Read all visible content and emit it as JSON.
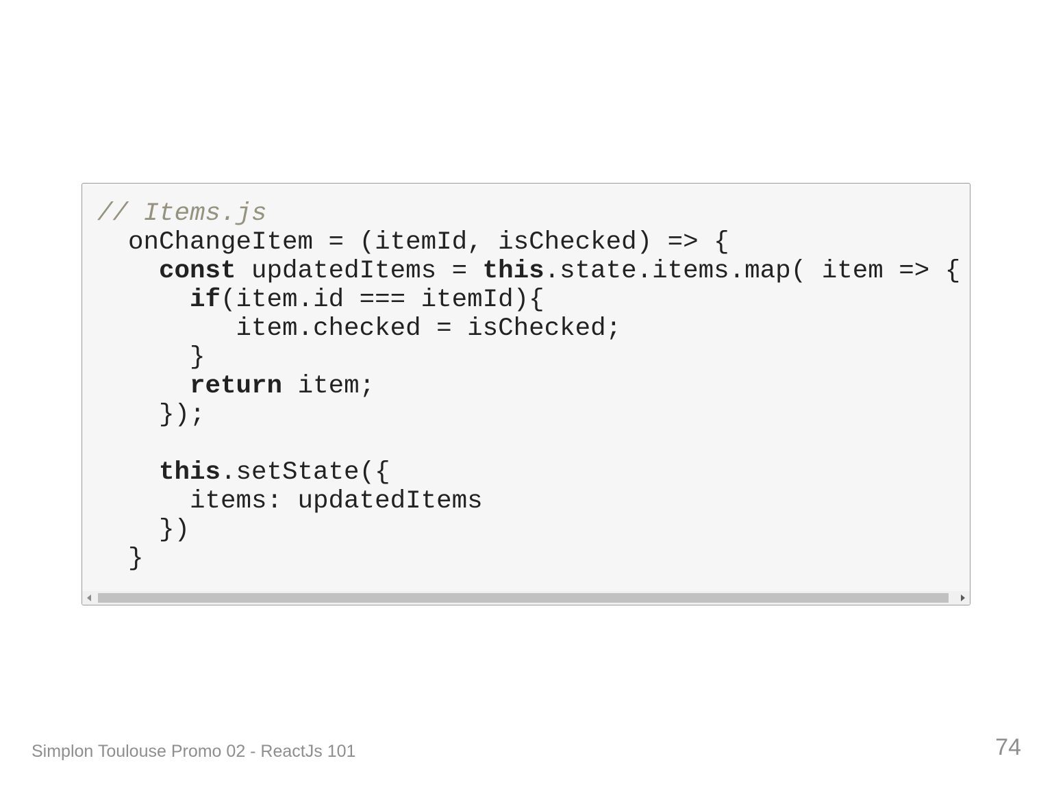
{
  "code": {
    "lines": [
      [
        {
          "t": "// Items.js",
          "s": "comment"
        }
      ],
      [
        {
          "t": "  onChangeItem = (itemId, isChecked) => {",
          "s": "plain"
        }
      ],
      [
        {
          "t": "    ",
          "s": "plain"
        },
        {
          "t": "const",
          "s": "kw"
        },
        {
          "t": " updatedItems = ",
          "s": "plain"
        },
        {
          "t": "this",
          "s": "kw"
        },
        {
          "t": ".state.items.map( item => {",
          "s": "plain"
        }
      ],
      [
        {
          "t": "      ",
          "s": "plain"
        },
        {
          "t": "if",
          "s": "kw"
        },
        {
          "t": "(item.id === itemId){",
          "s": "plain"
        }
      ],
      [
        {
          "t": "         item.checked = isChecked;",
          "s": "plain"
        }
      ],
      [
        {
          "t": "      }",
          "s": "plain"
        }
      ],
      [
        {
          "t": "      ",
          "s": "plain"
        },
        {
          "t": "return",
          "s": "kw"
        },
        {
          "t": " item;",
          "s": "plain"
        }
      ],
      [
        {
          "t": "    });",
          "s": "plain"
        }
      ],
      [
        {
          "t": "",
          "s": "plain"
        }
      ],
      [
        {
          "t": "    ",
          "s": "plain"
        },
        {
          "t": "this",
          "s": "kw"
        },
        {
          "t": ".setState({",
          "s": "plain"
        }
      ],
      [
        {
          "t": "      items: updatedItems",
          "s": "plain"
        }
      ],
      [
        {
          "t": "    })",
          "s": "plain"
        }
      ],
      [
        {
          "t": "  }",
          "s": "plain"
        }
      ]
    ]
  },
  "footer": {
    "text": "Simplon Toulouse Promo 02 - ReactJs 101",
    "page_number": "74"
  },
  "colors": {
    "code_background": "#f6f6f6",
    "comment": "#93937f",
    "code_text": "#222222",
    "footer_text": "#8e8e8e"
  }
}
